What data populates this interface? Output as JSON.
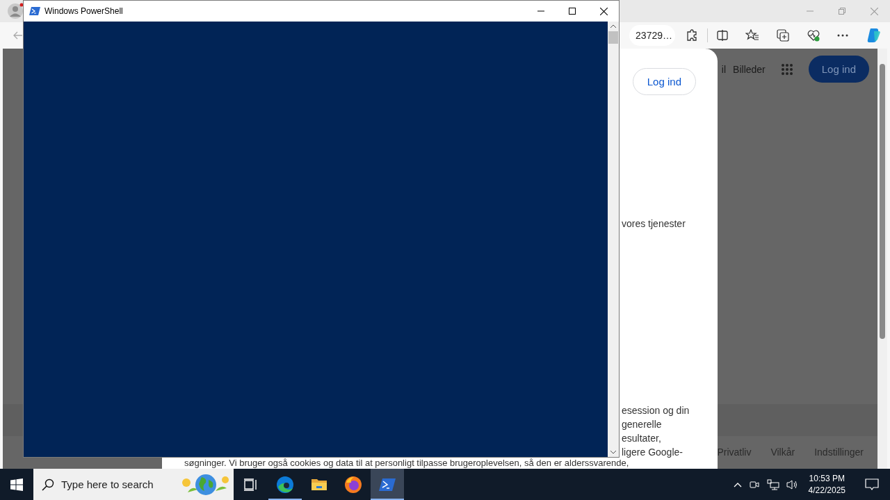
{
  "browser": {
    "address": "23729…",
    "nav_links": [
      "il",
      "Billeder"
    ],
    "sign_in_button": "Log ind",
    "consent_dialog": {
      "button": "Log ind",
      "text_line": "vores tjenester",
      "paragraph_lines": [
        "esession og din",
        "generelle",
        "esultater,",
        "ligere Google-"
      ],
      "bottom_line": "søgninger. Vi bruger også cookies og data til at personligt tilpasse brugeroplevelsen, så den er alderssvarende,"
    },
    "footer_links": [
      "Privatliv",
      "Vilkår",
      "Indstillinger"
    ]
  },
  "powershell": {
    "title": "Windows PowerShell"
  },
  "taskbar": {
    "search_placeholder": "Type here to search",
    "apps": [
      {
        "kind": "taskview",
        "running": false,
        "selected": false
      },
      {
        "kind": "edge",
        "running": true,
        "selected": false
      },
      {
        "kind": "explorer",
        "running": false,
        "selected": false
      },
      {
        "kind": "firefox",
        "running": false,
        "selected": false
      },
      {
        "kind": "powershell",
        "running": true,
        "selected": true
      }
    ],
    "time": "10:53 PM",
    "date": "4/22/2025"
  }
}
